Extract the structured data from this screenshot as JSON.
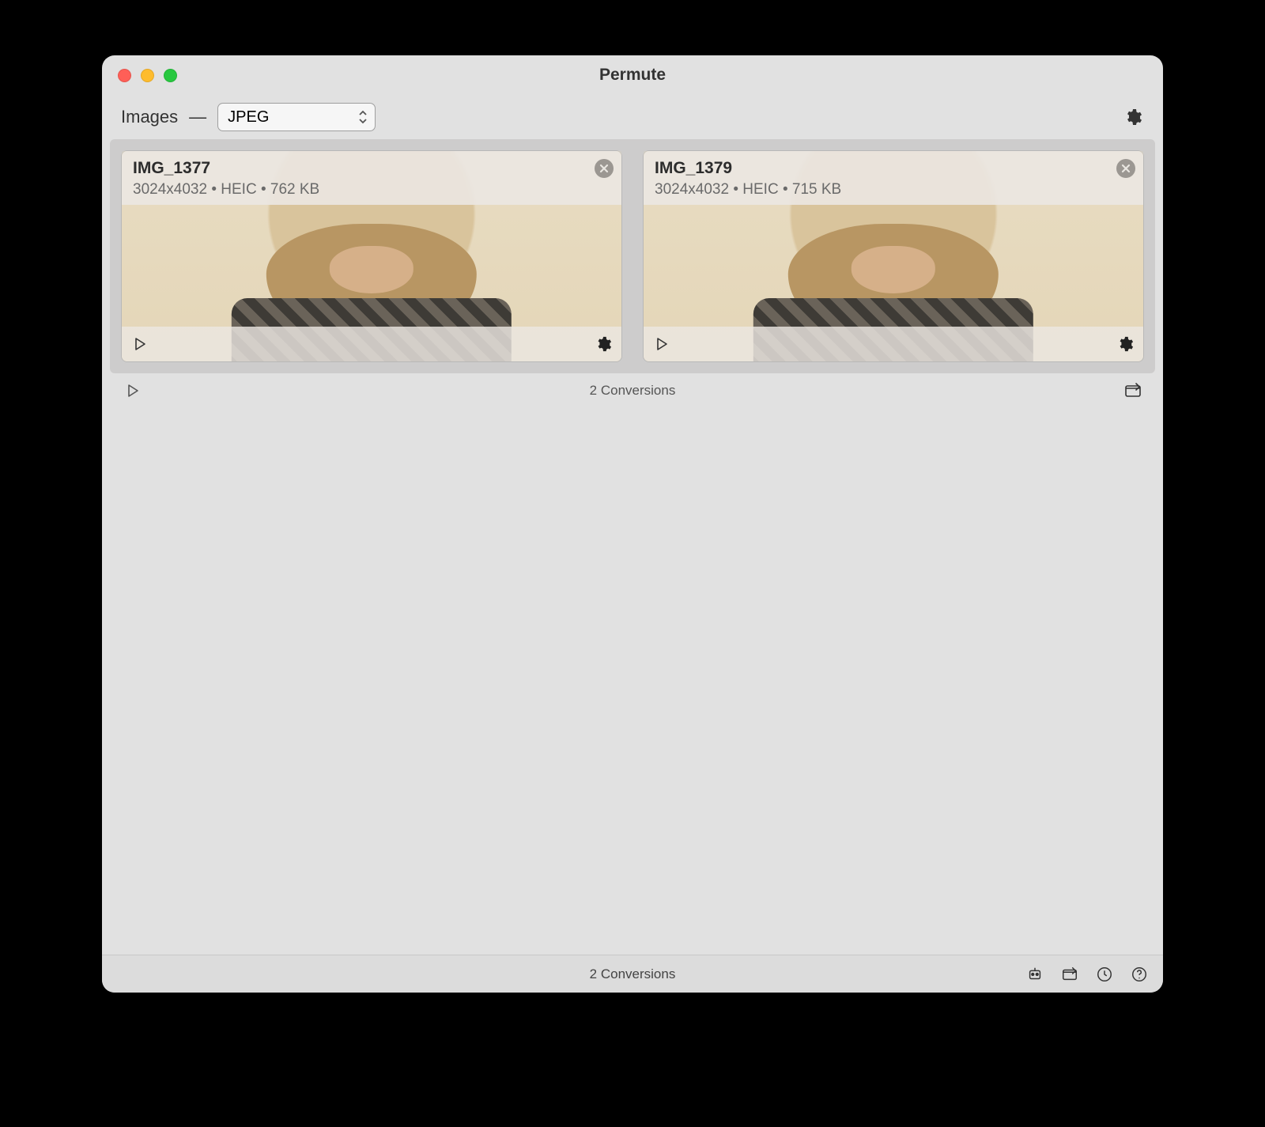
{
  "window": {
    "title": "Permute"
  },
  "toolbar": {
    "category_label": "Images",
    "separator": "—",
    "format_selected": "JPEG"
  },
  "items": [
    {
      "name": "IMG_1377",
      "dimensions": "3024x4032",
      "format": "HEIC",
      "size": "762 KB"
    },
    {
      "name": "IMG_1379",
      "dimensions": "3024x4032",
      "format": "HEIC",
      "size": "715 KB"
    }
  ],
  "strings": {
    "meta_sep": " • ",
    "conversions_header": "2 Conversions",
    "conversions_footer": "2 Conversions"
  }
}
